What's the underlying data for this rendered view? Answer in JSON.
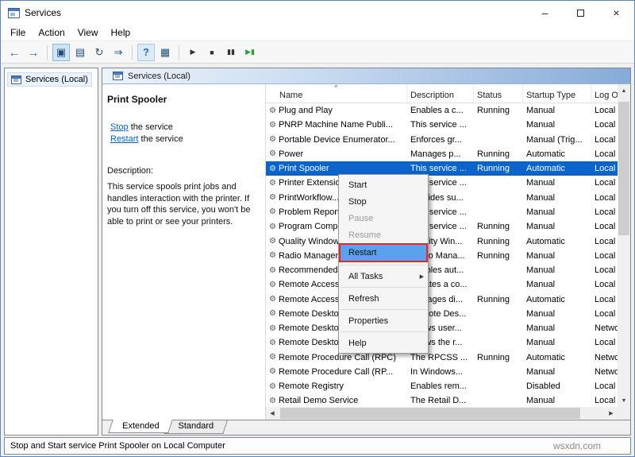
{
  "window": {
    "title": "Services",
    "minimize_glyph": "–",
    "close_glyph": "×"
  },
  "menu_bar": {
    "items": [
      "File",
      "Action",
      "View",
      "Help"
    ]
  },
  "toolbar": {
    "buttons": [
      {
        "name": "back-button",
        "glyph": "←",
        "style": "nav"
      },
      {
        "name": "forward-button",
        "glyph": "→",
        "style": "nav"
      },
      {
        "separator": true
      },
      {
        "name": "show-console-tree-button",
        "glyph": "▣",
        "style": "active"
      },
      {
        "name": "export-list-button",
        "glyph": "▤",
        "style": ""
      },
      {
        "name": "refresh-button",
        "glyph": "↻",
        "style": ""
      },
      {
        "name": "export-button",
        "glyph": "⇒",
        "style": ""
      },
      {
        "separator": true
      },
      {
        "name": "help-button",
        "glyph": "?",
        "style": "help"
      },
      {
        "name": "action-pane-button",
        "glyph": "▦",
        "style": ""
      },
      {
        "separator": true
      },
      {
        "name": "start-service-button",
        "glyph": "▶",
        "style": "media"
      },
      {
        "name": "stop-service-button",
        "glyph": "■",
        "style": "media"
      },
      {
        "name": "pause-service-button",
        "glyph": "▮▮",
        "style": "media"
      },
      {
        "name": "restart-service-button",
        "glyph": "▶▮",
        "style": "media green"
      }
    ]
  },
  "tree": {
    "root_label": "Services (Local)"
  },
  "panel_header": {
    "title": "Services (Local)"
  },
  "info_panel": {
    "service_name": "Print Spooler",
    "stop_link_text": "Stop",
    "stop_suffix": " the service",
    "restart_link_text": "Restart",
    "restart_suffix": " the service",
    "description_label": "Description:",
    "description_text": "This service spools print jobs and handles interaction with the printer. If you turn off this service, you won't be able to print or see your printers."
  },
  "table": {
    "sort_glyph": "^",
    "row_icon_glyph": "⚙",
    "columns": [
      {
        "label": "Name",
        "sorted": true
      },
      {
        "label": "Description"
      },
      {
        "label": "Status"
      },
      {
        "label": "Startup Type"
      },
      {
        "label": "Log O..."
      }
    ],
    "rows": [
      {
        "name": "Plug and Play",
        "desc": "Enables a c...",
        "status": "Running",
        "startup": "Manual",
        "logon": "Local"
      },
      {
        "name": "PNRP Machine Name Publi...",
        "desc": "This service ...",
        "status": "",
        "startup": "Manual",
        "logon": "Local"
      },
      {
        "name": "Portable Device Enumerator...",
        "desc": "Enforces gr...",
        "status": "",
        "startup": "Manual (Trig...",
        "logon": "Local"
      },
      {
        "name": "Power",
        "desc": "Manages p...",
        "status": "Running",
        "startup": "Automatic",
        "logon": "Local"
      },
      {
        "name": "Print Spooler",
        "desc": "This service ...",
        "status": "Running",
        "startup": "Automatic",
        "logon": "Local",
        "selected": true
      },
      {
        "name": "Printer Extensions and N...",
        "desc": "This service ...",
        "status": "",
        "startup": "Manual",
        "logon": "Local"
      },
      {
        "name": "PrintWorkflow...",
        "desc": "Provides su...",
        "status": "",
        "startup": "Manual",
        "logon": "Local"
      },
      {
        "name": "Problem Reports and Sol...",
        "desc": "This service ...",
        "status": "",
        "startup": "Manual",
        "logon": "Local"
      },
      {
        "name": "Program Compatibility A...",
        "desc": "This service ...",
        "status": "Running",
        "startup": "Manual",
        "logon": "Local"
      },
      {
        "name": "Quality Windows Audio V...",
        "desc": "Quality Win...",
        "status": "Running",
        "startup": "Automatic",
        "logon": "Local"
      },
      {
        "name": "Radio Management Serv...",
        "desc": "Radio Mana...",
        "status": "Running",
        "startup": "Manual",
        "logon": "Local"
      },
      {
        "name": "Recommended Troubles...",
        "desc": "Enables aut...",
        "status": "",
        "startup": "Manual",
        "logon": "Local"
      },
      {
        "name": "Remote Access Auto Con...",
        "desc": "Creates a co...",
        "status": "",
        "startup": "Manual",
        "logon": "Local"
      },
      {
        "name": "Remote Access Connecti...",
        "desc": "Manages di...",
        "status": "Running",
        "startup": "Automatic",
        "logon": "Local"
      },
      {
        "name": "Remote Desktop Configu...",
        "desc": "Remote Des...",
        "status": "",
        "startup": "Manual",
        "logon": "Local"
      },
      {
        "name": "Remote Desktop Services",
        "desc": "Allows user...",
        "status": "",
        "startup": "Manual",
        "logon": "Netwo..."
      },
      {
        "name": "Remote Desktop Services Um...",
        "desc": "Allows the r...",
        "status": "",
        "startup": "Manual",
        "logon": "Local"
      },
      {
        "name": "Remote Procedure Call (RPC)",
        "desc": "The RPCSS ...",
        "status": "Running",
        "startup": "Automatic",
        "logon": "Netwo..."
      },
      {
        "name": "Remote Procedure Call (RP...",
        "desc": "In Windows...",
        "status": "",
        "startup": "Manual",
        "logon": "Netwo..."
      },
      {
        "name": "Remote Registry",
        "desc": "Enables rem...",
        "status": "",
        "startup": "Disabled",
        "logon": "Local"
      },
      {
        "name": "Retail Demo Service",
        "desc": "The Retail D...",
        "status": "",
        "startup": "Manual",
        "logon": "Local"
      }
    ]
  },
  "context_menu": {
    "submenu_arrow": "▶",
    "items": [
      {
        "label": "Start"
      },
      {
        "label": "Stop"
      },
      {
        "label": "Pause",
        "disabled": true
      },
      {
        "label": "Resume",
        "disabled": true
      },
      {
        "label": "Restart",
        "highlighted": true
      },
      {
        "separator": true
      },
      {
        "label": "All Tasks",
        "submenu": true
      },
      {
        "separator": true
      },
      {
        "label": "Refresh"
      },
      {
        "separator": true
      },
      {
        "label": "Properties"
      },
      {
        "separator": true
      },
      {
        "label": "Help"
      }
    ]
  },
  "tabs": [
    {
      "label": "Extended",
      "active": true
    },
    {
      "label": "Standard"
    }
  ],
  "scrollbar": {
    "up": "▲",
    "down": "▼",
    "left": "◀",
    "right": "▶"
  },
  "status_bar": {
    "text": "Stop and Start service Print Spooler on Local Computer"
  },
  "watermark": {
    "text": "wsxdn.com"
  }
}
